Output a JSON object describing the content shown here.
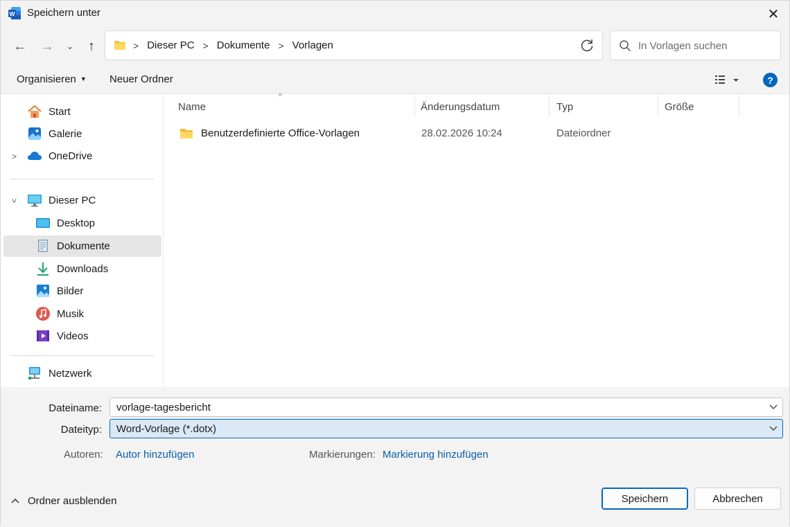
{
  "window": {
    "title": "Speichern unter",
    "close_glyph": "✕"
  },
  "nav": {
    "back_glyph": "←",
    "forward_glyph": "→",
    "history_glyph": "⌄",
    "up_glyph": "↑"
  },
  "breadcrumbs": [
    "Dieser PC",
    "Dokumente",
    "Vorlagen"
  ],
  "search": {
    "placeholder": "In Vorlagen suchen"
  },
  "toolbar": {
    "organize_label": "Organisieren",
    "new_folder_label": "Neuer Ordner",
    "help_label": "?"
  },
  "sidebar": {
    "quick": [
      {
        "label": "Start",
        "icon": "home-icon"
      },
      {
        "label": "Galerie",
        "icon": "gallery-icon"
      },
      {
        "label": "OneDrive",
        "icon": "cloud-icon"
      }
    ],
    "pc": {
      "label": "Dieser PC",
      "icon": "computer-icon"
    },
    "pc_items": [
      {
        "label": "Desktop",
        "icon": "desktop-icon"
      },
      {
        "label": "Dokumente",
        "icon": "documents-icon",
        "selected": true
      },
      {
        "label": "Downloads",
        "icon": "download-icon"
      },
      {
        "label": "Bilder",
        "icon": "pictures-icon"
      },
      {
        "label": "Musik",
        "icon": "music-icon"
      },
      {
        "label": "Videos",
        "icon": "videos-icon"
      }
    ],
    "network": {
      "label": "Netzwerk",
      "icon": "network-icon"
    }
  },
  "columns": {
    "name": "Name",
    "date": "Änderungsdatum",
    "type": "Typ",
    "size": "Größe"
  },
  "files": [
    {
      "name": "Benutzerdefinierte Office-Vorlagen",
      "date": "28.02.2026 10:24",
      "type": "Dateiordner",
      "size": ""
    }
  ],
  "form": {
    "filename_label": "Dateiname:",
    "filename_value": "vorlage-tagesbericht",
    "filetype_label": "Dateityp:",
    "filetype_value": "Word-Vorlage (*.dotx)",
    "authors_label": "Autoren:",
    "authors_link": "Autor hinzufügen",
    "tags_label": "Markierungen:",
    "tags_link": "Markierung hinzufügen"
  },
  "footer": {
    "hide_folders_label": "Ordner ausblenden",
    "save_label": "Speichern",
    "cancel_label": "Abbrechen"
  },
  "colors": {
    "accent": "#0067c0",
    "link": "#0a5ea8",
    "chrome": "#f3f3f3",
    "selection": "#e5e5e5"
  }
}
